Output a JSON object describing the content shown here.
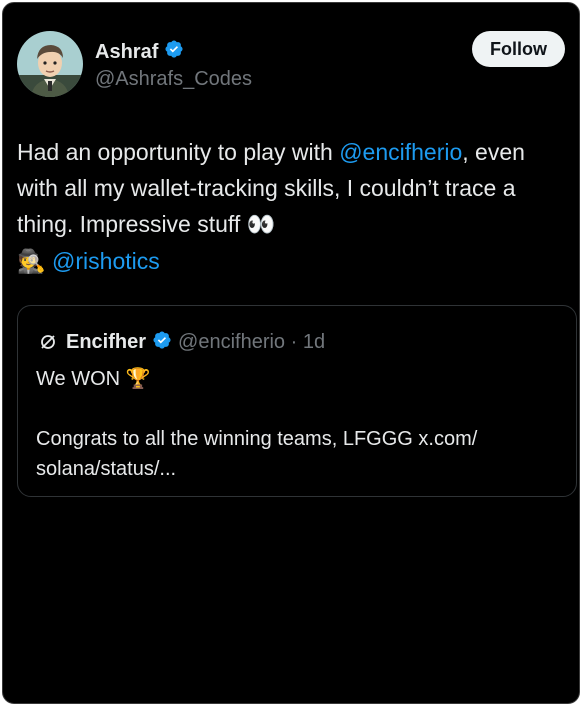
{
  "tweet": {
    "author": {
      "name": "Ashraf",
      "handle": "@Ashrafs_Codes",
      "verified": true
    },
    "follow_label": "Follow",
    "text": {
      "part1": "Had an opportunity to play with ",
      "mention1": "@encifherio",
      "part2": ", even with all my wallet-tracking skills, I couldn’t trace a thing. Impressive stuff ",
      "emoji_eyes": "👀",
      "emoji_detective": "🕵️",
      "mention2": "@rishotics"
    },
    "quoted": {
      "name": "Encifher",
      "handle_time": "@encifherio · 1d",
      "verified": true,
      "line1": "We WON ",
      "line1_emoji": "🏆",
      "line2": "Congrats to all the winning teams, LFGGG x.com/ solana/status/..."
    }
  },
  "colors": {
    "background": "#000000",
    "text": "#e7e9ea",
    "muted": "#71767b",
    "link": "#1d9bf0",
    "verified": "#1d9bf0",
    "follow_bg": "#eff3f4"
  },
  "icons": [
    "avatar",
    "verified-badge-icon",
    "encifher-logo-icon",
    "eyes-emoji",
    "detective-emoji",
    "trophy-emoji"
  ]
}
